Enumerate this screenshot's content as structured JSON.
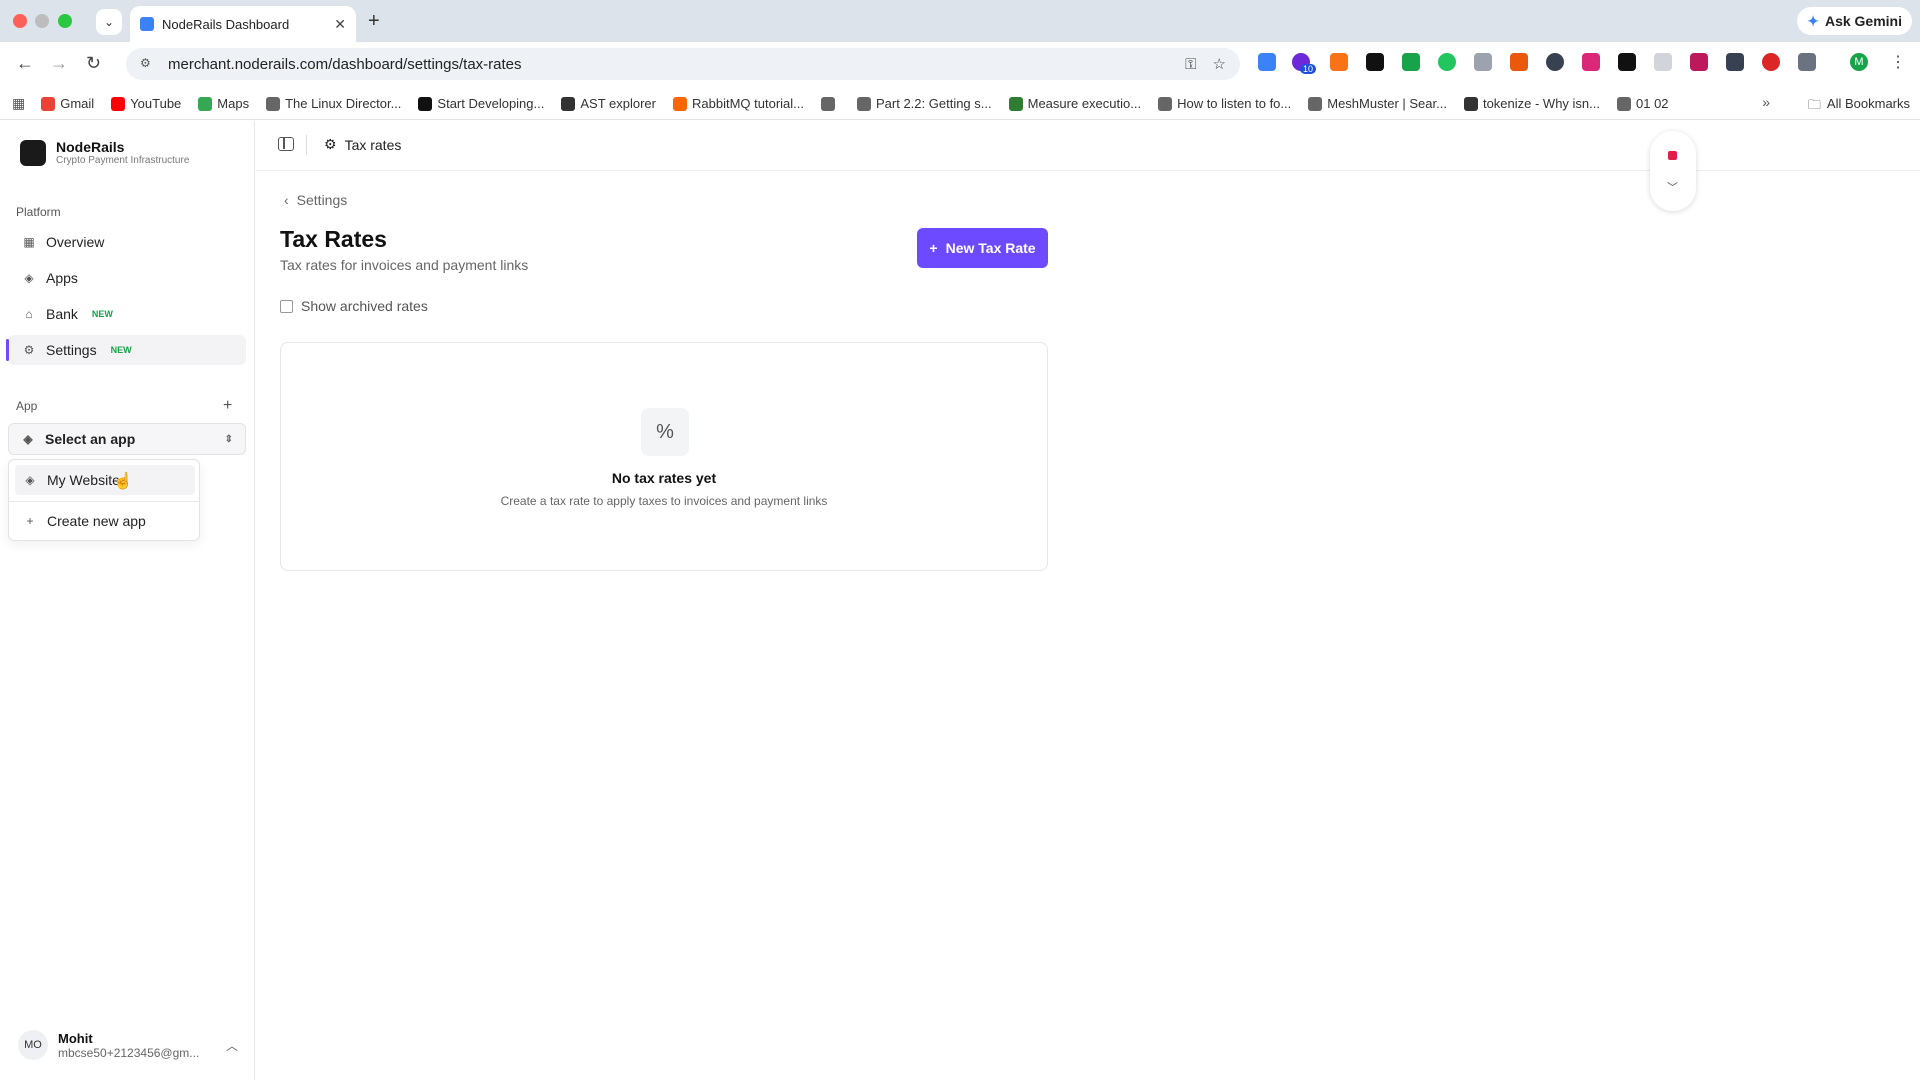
{
  "browser": {
    "tab_title": "NodeRails Dashboard",
    "url": "merchant.noderails.com/dashboard/settings/tax-rates",
    "gemini_label": "Ask Gemini",
    "ext_badge": "10",
    "profile_initial": "M",
    "bookmarks": [
      {
        "label": "Gmail",
        "color": "#ea4335"
      },
      {
        "label": "YouTube",
        "color": "#ff0000"
      },
      {
        "label": "Maps",
        "color": "#34a853"
      },
      {
        "label": "The Linux Director...",
        "color": "#666666"
      },
      {
        "label": "Start Developing...",
        "color": "#111111"
      },
      {
        "label": "AST explorer",
        "color": "#333333"
      },
      {
        "label": "RabbitMQ tutorial...",
        "color": "#ff6600"
      },
      {
        "label": "",
        "color": "#666666"
      },
      {
        "label": "Part 2.2: Getting s...",
        "color": "#666666"
      },
      {
        "label": "Measure executio...",
        "color": "#2e7d32"
      },
      {
        "label": "How to listen to fo...",
        "color": "#666666"
      },
      {
        "label": "MeshMuster | Sear...",
        "color": "#666666"
      },
      {
        "label": "tokenize - Why isn...",
        "color": "#333333"
      },
      {
        "label": "01 02",
        "color": "#666666"
      }
    ],
    "all_bookmarks": "All Bookmarks"
  },
  "brand": {
    "name": "NodeRails",
    "subtitle": "Crypto Payment Infrastructure"
  },
  "sidebar": {
    "platform_label": "Platform",
    "items": [
      {
        "label": "Overview",
        "icon": "grid-icon",
        "badge": ""
      },
      {
        "label": "Apps",
        "icon": "layers-icon",
        "badge": ""
      },
      {
        "label": "Bank",
        "icon": "bank-icon",
        "badge": "NEW"
      },
      {
        "label": "Settings",
        "icon": "gear-icon",
        "badge": "NEW"
      }
    ],
    "app_label": "App",
    "app_select": "Select an app",
    "app_menu": {
      "app_item": "My Website",
      "create_item": "Create new app"
    },
    "user": {
      "initials": "MO",
      "name": "Mohit",
      "email": "mbcse50+2123456@gm..."
    }
  },
  "topbar": {
    "crumb": "Tax rates"
  },
  "main": {
    "back_label": "Settings",
    "title": "Tax Rates",
    "subtitle": "Tax rates for invoices and payment links",
    "new_button": "New Tax Rate",
    "show_archived": "Show archived rates",
    "empty_title": "No tax rates yet",
    "empty_sub": "Create a tax rate to apply taxes to invoices and payment links"
  },
  "colors": {
    "accent": "#6d4aff",
    "new_badge": "#16a34a",
    "record": "#e11d48"
  }
}
